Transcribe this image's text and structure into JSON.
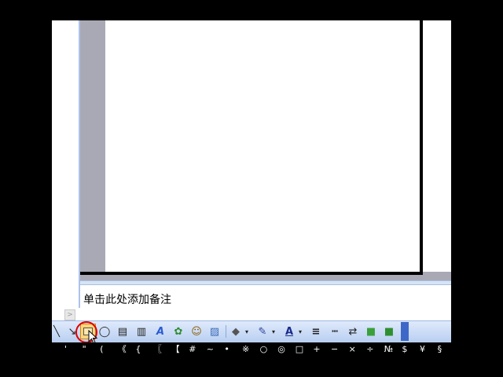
{
  "notes_pane": {
    "placeholder": "单击此处添加备注"
  },
  "left_pane": {
    "scroll_right_glyph": ">"
  },
  "drawing_toolbar": {
    "buttons": [
      {
        "name": "line-tool",
        "glyph": "╲"
      },
      {
        "name": "arrow-tool",
        "glyph": "↘"
      },
      {
        "name": "rectangle-tool",
        "glyph": ""
      },
      {
        "name": "oval-tool",
        "glyph": "◯"
      },
      {
        "name": "text-box-tool",
        "glyph": "▤"
      },
      {
        "name": "vertical-text-box-tool",
        "glyph": "▥"
      },
      {
        "name": "wordart-tool",
        "glyph": "A"
      },
      {
        "name": "diagram-tool",
        "glyph": "✿"
      },
      {
        "name": "clip-art-tool",
        "glyph": "☺"
      },
      {
        "name": "insert-picture-tool",
        "glyph": "▨"
      },
      {
        "name": "fill-color-tool",
        "glyph": "◆"
      },
      {
        "name": "line-color-tool",
        "glyph": "✎"
      },
      {
        "name": "font-color-tool",
        "glyph": "A"
      },
      {
        "name": "line-style-tool",
        "glyph": "≡"
      },
      {
        "name": "dash-style-tool",
        "glyph": "┅"
      },
      {
        "name": "arrow-style-tool",
        "glyph": "⇄"
      },
      {
        "name": "shadow-style-tool",
        "glyph": "■"
      },
      {
        "name": "3d-style-tool",
        "glyph": "■"
      }
    ],
    "dropdown_glyph": "▾"
  },
  "symbol_bar": {
    "symbols": [
      "'",
      "\"",
      "(",
      "《",
      "{",
      "〖",
      "【",
      "#",
      "~",
      "•",
      "※",
      "○",
      "◎",
      "□",
      "+",
      "−",
      "×",
      "÷",
      "№",
      "$",
      "¥",
      "§"
    ]
  },
  "colors": {
    "toolbar_top": "#dfeafb",
    "toolbar_bottom": "#b8cff1",
    "slide_workspace": "#a9a9b5",
    "highlight": "#e00000",
    "selected_button": "#ffd47a"
  }
}
